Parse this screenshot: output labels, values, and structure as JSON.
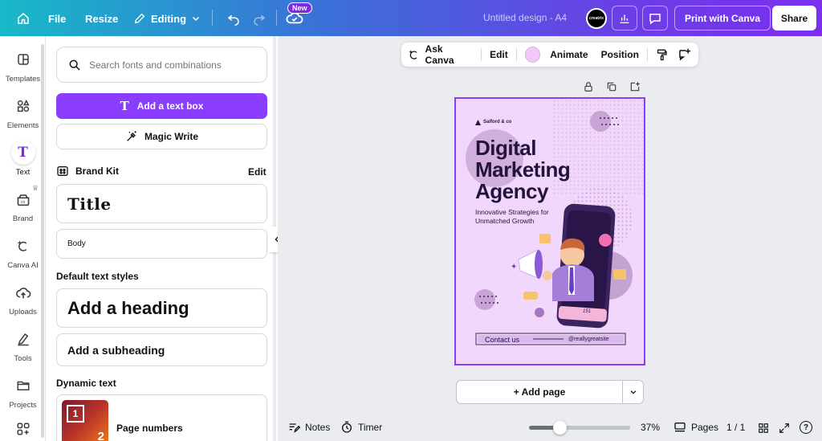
{
  "topbar": {
    "file": "File",
    "resize": "Resize",
    "editing": "Editing",
    "new_badge": "New",
    "doc_title": "Untitled design - A4",
    "print": "Print with Canva",
    "share": "Share",
    "avatar_text": "creatrix"
  },
  "sidebar": {
    "items": [
      {
        "label": "Templates"
      },
      {
        "label": "Elements"
      },
      {
        "label": "Text"
      },
      {
        "label": "Brand"
      },
      {
        "label": "Canva AI"
      },
      {
        "label": "Uploads"
      },
      {
        "label": "Tools"
      },
      {
        "label": "Projects"
      }
    ]
  },
  "panel": {
    "search_placeholder": "Search fonts and combinations",
    "add_text_box": "Add a text box",
    "magic_write": "Magic Write",
    "brand_kit": "Brand Kit",
    "edit": "Edit",
    "title_style": "Title",
    "body_style": "Body",
    "default_styles": "Default text styles",
    "heading": "Add a heading",
    "subheading": "Add a subheading",
    "dynamic_text": "Dynamic text",
    "page_numbers": "Page numbers",
    "page_number_thumb": "2"
  },
  "toolbar": {
    "ask_canva": "Ask Canva",
    "edit": "Edit",
    "animate": "Animate",
    "position": "Position",
    "swatch_color": "#f2c8fb"
  },
  "design": {
    "brand": "Salford & co",
    "title_lines": [
      "Digital",
      "Marketing",
      "Agency"
    ],
    "subtitle_lines": [
      "Innovative Strategies for",
      "Unmatched Growth"
    ],
    "contact": "Contact us",
    "site": "@reallygreatsite",
    "phone_count": "151"
  },
  "add_page": "+ Add page",
  "bottombar": {
    "notes": "Notes",
    "timer": "Timer",
    "zoom": "37%",
    "zoom_level": 0.3,
    "pages": "Pages",
    "page_count": "1 / 1"
  },
  "colors": {
    "accent": "#8b3dff",
    "design_bg": "#f0d7fb"
  }
}
